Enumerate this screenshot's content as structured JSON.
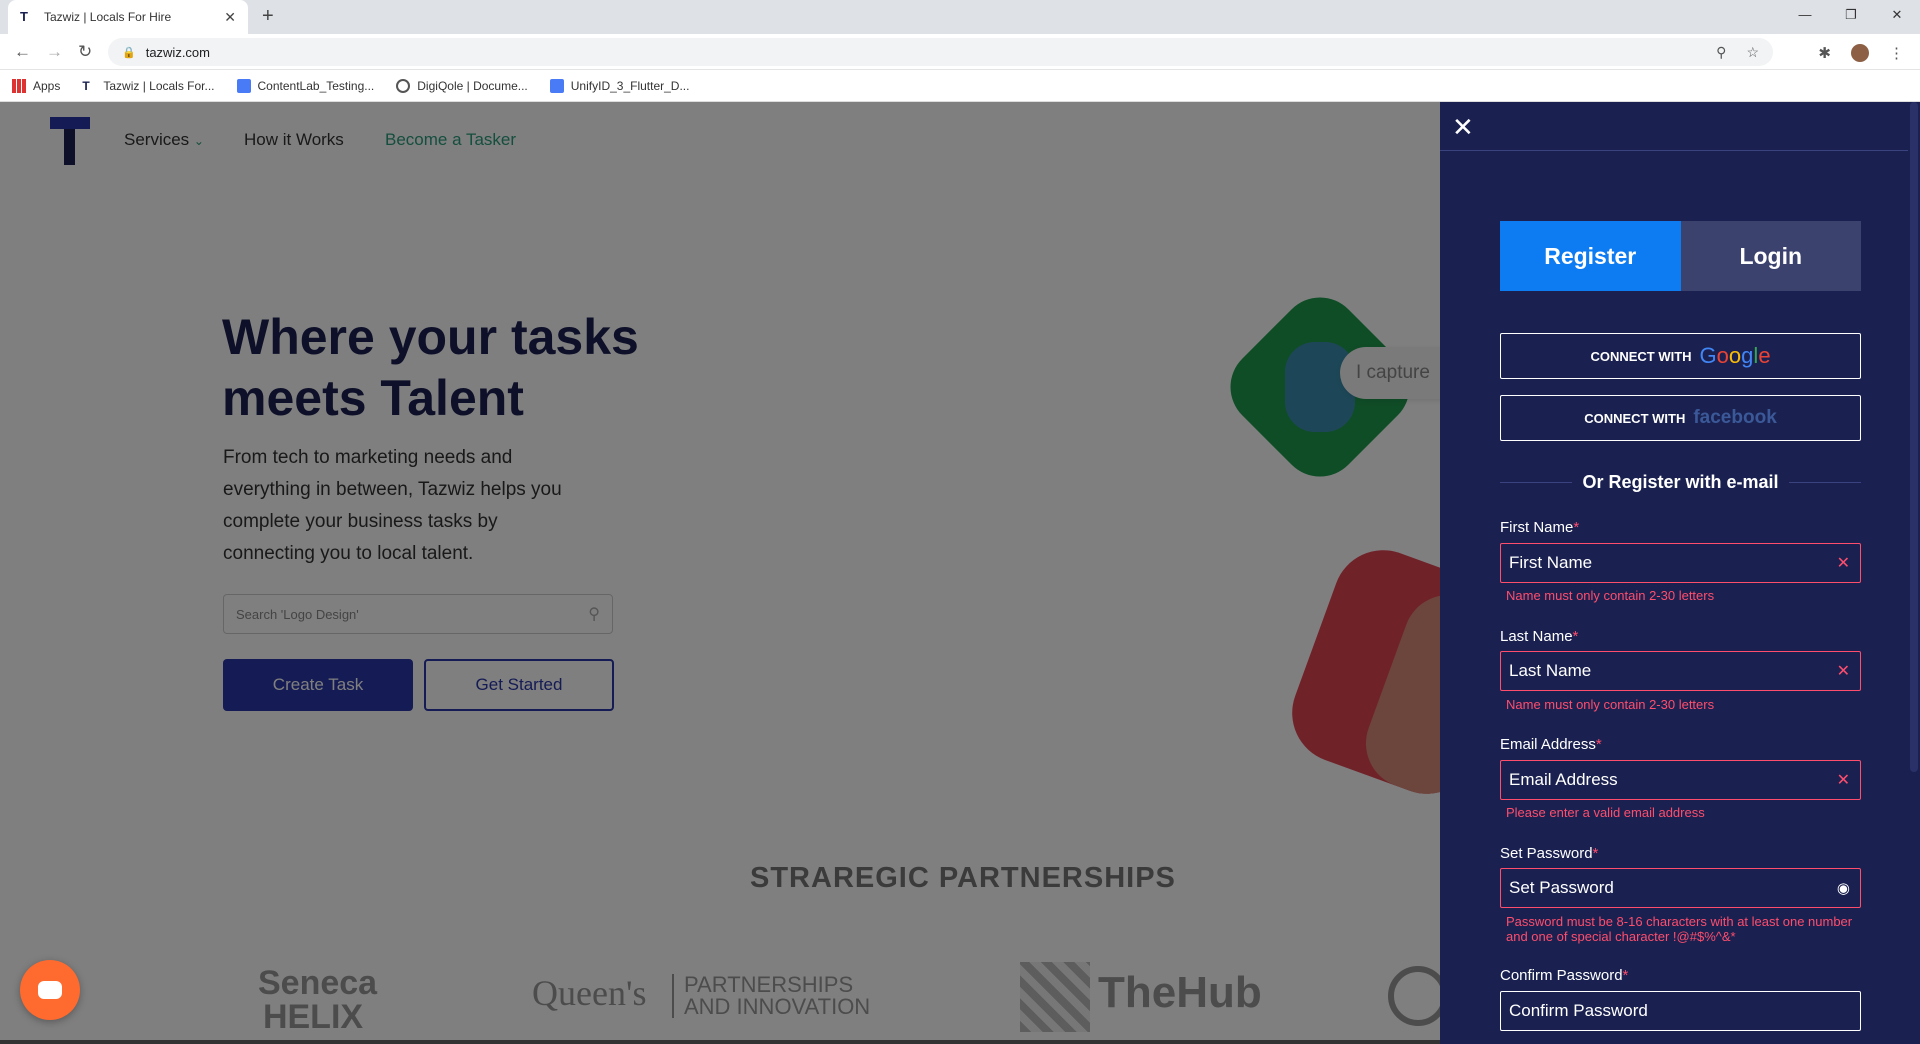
{
  "browser": {
    "tab_title": "Tazwiz | Locals For Hire",
    "tab_close": "✕",
    "new_tab": "+",
    "url": "tazwiz.com",
    "window_controls": [
      "—",
      "❐",
      "✕"
    ],
    "bookmarks": [
      {
        "label": "Apps",
        "icon": "apps-grid-icon"
      },
      {
        "label": "Tazwiz | Locals For...",
        "icon": "tazwiz-favicon"
      },
      {
        "label": "ContentLab_Testing...",
        "icon": "google-docs-icon"
      },
      {
        "label": "DigiQole | Docume...",
        "icon": "globe-icon"
      },
      {
        "label": "UnifyID_3_Flutter_D...",
        "icon": "google-docs-icon"
      }
    ]
  },
  "site": {
    "nav": {
      "services": "Services",
      "how_it_works": "How it Works",
      "become_tasker": "Become a Tasker"
    },
    "hero": {
      "title": "Where your tasks meets Talent",
      "subtitle": "From tech to marketing needs and everything in between, Tazwiz helps you complete your business tasks by connecting you to local talent.",
      "search_placeholder": "Search 'Logo Design'",
      "create_task": "Create Task",
      "get_started": "Get Started",
      "bubble_text": "I capture"
    },
    "partners": {
      "heading": "STRAREGIC PARTNERSHIPS",
      "logos": [
        "Seneca HELIX",
        "Queen's",
        "PARTNERSHIPS AND INNOVATION",
        "TheHub"
      ]
    }
  },
  "panel": {
    "tabs": {
      "register": "Register",
      "login": "Login"
    },
    "connect_with": "CONNECT WITH",
    "google": "Google",
    "facebook": "facebook",
    "or_register": "Or Register with e-mail",
    "required_mark": "*",
    "fields": [
      {
        "label": "First Name",
        "placeholder": "First Name",
        "error": "Name must only contain 2-30 letters"
      },
      {
        "label": "Last Name",
        "placeholder": "Last Name",
        "error": "Name must only contain 2-30 letters"
      },
      {
        "label": "Email Address",
        "placeholder": "Email Address",
        "error": "Please enter a valid email address"
      },
      {
        "label": "Set Password",
        "placeholder": "Set Password",
        "error": "Password must be 8-16 characters with at least one number and one of special character !@#$%^&*"
      },
      {
        "label": "Confirm Password",
        "placeholder": "Confirm Password"
      }
    ]
  },
  "colors": {
    "brand_navy": "#1a2150",
    "brand_blue": "#2b37a8",
    "register_tab": "#0d7cf2",
    "error": "#ff4d6d",
    "tasker_link": "#2a9d7c"
  }
}
